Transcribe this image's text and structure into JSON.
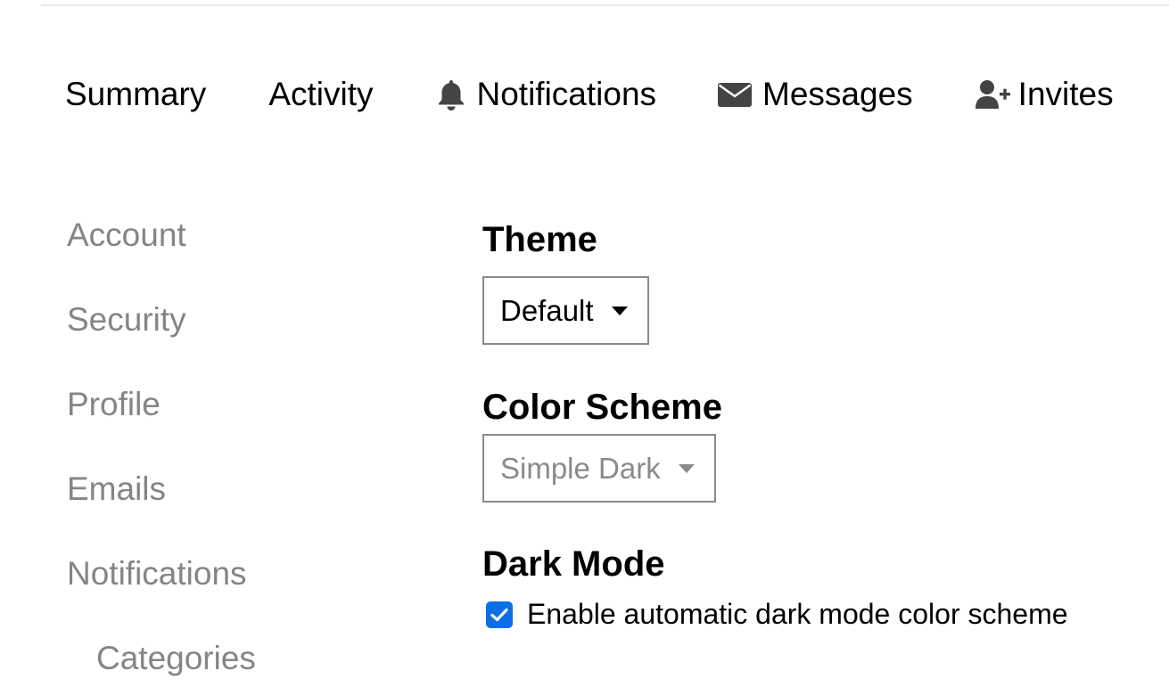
{
  "nav": {
    "summary": "Summary",
    "activity": "Activity",
    "notifications": {
      "label": "Notifications",
      "icon": "bell-icon"
    },
    "messages": {
      "label": "Messages",
      "icon": "envelope-icon"
    },
    "invites": {
      "label": "Invites",
      "icon": "user-plus-icon"
    }
  },
  "sidebar": {
    "items": [
      {
        "label": "Account"
      },
      {
        "label": "Security"
      },
      {
        "label": "Profile"
      },
      {
        "label": "Emails"
      },
      {
        "label": "Notifications"
      },
      {
        "label": "Categories"
      }
    ]
  },
  "main": {
    "theme": {
      "title": "Theme",
      "selected": "Default"
    },
    "color_scheme": {
      "title": "Color Scheme",
      "selected": "Simple Dark",
      "disabled": true
    },
    "dark_mode": {
      "title": "Dark Mode",
      "checkbox_label": "Enable automatic dark mode color scheme",
      "checked": true
    }
  },
  "colors": {
    "checkbox_accent": "#0b70e6",
    "sidebar_text": "#858585",
    "icon": "#444444",
    "border": "#8a8a8a"
  }
}
